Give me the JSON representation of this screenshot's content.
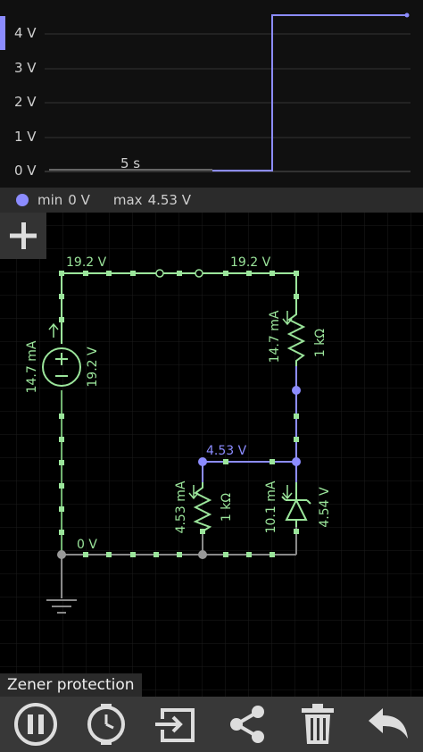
{
  "scope": {
    "y_ticks": [
      "4 V",
      "3 V",
      "2 V",
      "1 V",
      "0 V"
    ],
    "time_label": "5 s",
    "trace_color": "#8c8cff",
    "legend": {
      "min_label": "min",
      "min_value": "0 V",
      "max_label": "max",
      "max_value": "4.53 V"
    }
  },
  "circuit": {
    "top_left_voltage": "19.2 V",
    "top_right_voltage": "19.2 V",
    "source_current": "14.7 mA",
    "source_voltage": "19.2 V",
    "r1_current": "14.7 mA",
    "r1_value": "1 kΩ",
    "node_voltage": "4.53 V",
    "r2_current": "4.53 mA",
    "r2_value": "1 kΩ",
    "zener_current": "10.1 mA",
    "zener_voltage": "4.54 V",
    "ground_voltage": "0 V",
    "name": "Zener protection",
    "colors": {
      "wire_high": "#9be59b",
      "wire_node": "#8c8cff",
      "text": "#9be59b"
    }
  },
  "toolbar": {
    "icons": [
      "pause-icon",
      "stopwatch-icon",
      "export-icon",
      "share-icon",
      "trash-icon",
      "undo-icon"
    ]
  }
}
